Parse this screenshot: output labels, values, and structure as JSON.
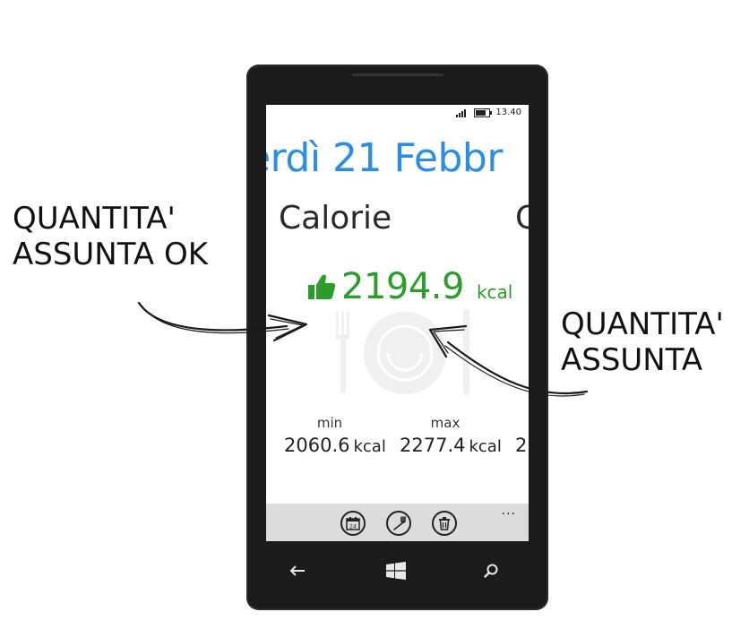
{
  "annotations": {
    "left": [
      "QUANTITA'",
      "ASSUNTA OK"
    ],
    "right": [
      "QUANTITA'",
      "ASSUNTA"
    ]
  },
  "statusbar": {
    "time": "13.40",
    "icons": [
      "signal-icon",
      "battery-icon"
    ]
  },
  "pivot": {
    "title": "erdì 21 Febbr"
  },
  "section": {
    "header": "Calorie",
    "next_header": "C"
  },
  "intake": {
    "icon": "thumbs-up-icon",
    "value": "2194.9",
    "unit": "kcal",
    "status_color": "#2a9d2a"
  },
  "stats": {
    "min_label": "min",
    "min_value": "2060.6",
    "max_label": "max",
    "max_value": "2277.4",
    "unit": "kcal",
    "partial_value": "2"
  },
  "appbar": {
    "buttons": [
      "calendar-icon",
      "fork-icon",
      "trash-icon"
    ],
    "calendar_day": "24",
    "more": "..."
  },
  "navbar": {
    "keys": [
      "back-icon",
      "windows-icon",
      "search-icon"
    ]
  },
  "colors": {
    "accent": "#2a8ee6",
    "ok": "#2a9d2a",
    "appbar": "#dcdcdc",
    "phone": "#1b1b1b"
  }
}
